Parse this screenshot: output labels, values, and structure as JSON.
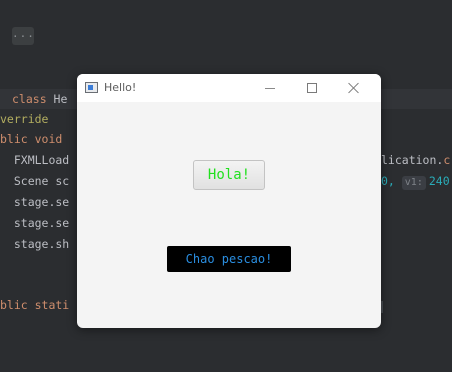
{
  "editor": {
    "fold_chip": "...",
    "lines": {
      "l1_kw": "class ",
      "l1_name": "He",
      "l2_ann": "verride",
      "l3_kw": "blic void",
      "l4": "  FXMLLoad",
      "l5": "  Scene sc",
      "l6": "  stage.se",
      "l7": "  stage.se",
      "l8": "  stage.sh",
      "l9_kw": "blic stati"
    },
    "right": {
      "r4_prefix": "lication.",
      "r4_suffix": "c",
      "r5_num1": "0, ",
      "r5_hint": "v1:",
      "r5_num2": "240"
    }
  },
  "window": {
    "title": "Hello!",
    "app_icon": "java-app-icon",
    "controls": {
      "minimize": "minimize-icon",
      "maximize": "maximize-icon",
      "close": "close-icon"
    },
    "button_label": "Hola!",
    "label_text": "Chao pescao!",
    "button_text_color": "#22e01f",
    "label_text_color": "#2a8ee0",
    "label_background": "#000000"
  }
}
